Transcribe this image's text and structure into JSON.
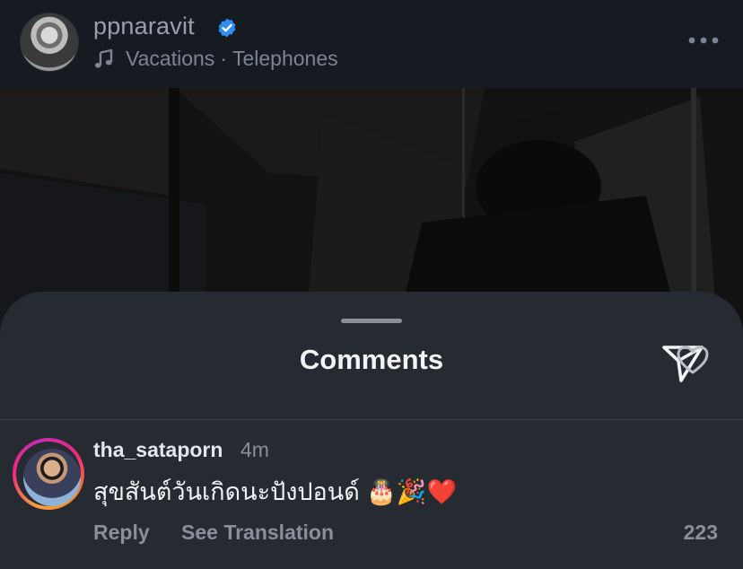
{
  "header": {
    "username": "ppnaravit",
    "verified": true,
    "music": {
      "icon": "music-note-icon",
      "song": "Vacations",
      "separator": "·",
      "artist": "Telephones"
    },
    "more_icon": "more-horizontal-icon"
  },
  "sheet": {
    "title": "Comments",
    "share_icon": "send-icon"
  },
  "comments": [
    {
      "username": "tha_sataporn",
      "time": "4m",
      "text": "สุขสันต์วันเกิดนะปังปอนด์ 🎂🎉❤️",
      "reply_label": "Reply",
      "translate_label": "See Translation",
      "like_count": "223",
      "has_story": true
    }
  ],
  "colors": {
    "header_bg": "#161a21",
    "sheet_bg": "#262a31",
    "verified_blue": "#2f8ff0",
    "primary_text": "#f2f3f5",
    "secondary_text": "#8a909a"
  }
}
